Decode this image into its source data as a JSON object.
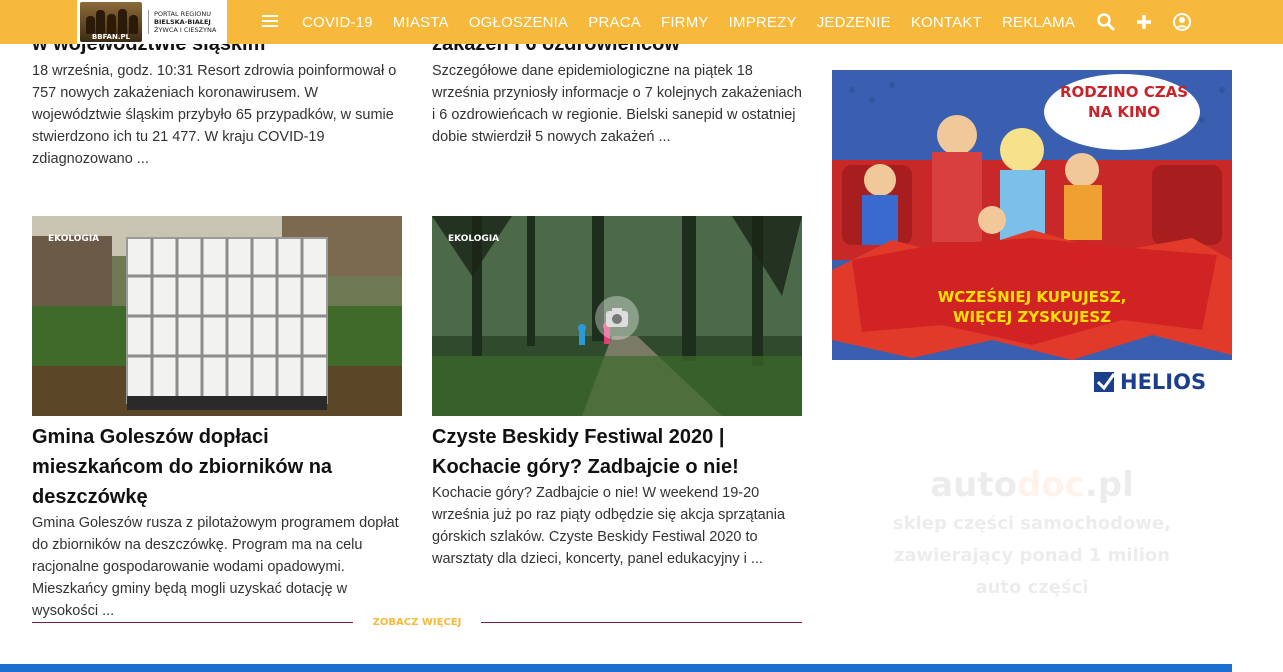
{
  "header": {
    "logo_word": "BBFAN.PL",
    "logo_line1": "PORTAL REGIONU",
    "logo_line2": "BIELSKA-BIAŁEJ",
    "logo_line3": "ŻYWCA I CIESZYNA",
    "nav": [
      "COVID-19",
      "MIASTA",
      "OGŁOSZENIA",
      "PRACA",
      "FIRMY",
      "IMPREZY",
      "JEDZENIE",
      "KONTAKT",
      "REKLAMA"
    ],
    "icons": [
      "search-icon",
      "plus-icon",
      "user-icon"
    ],
    "color": "#f6b93b"
  },
  "articles_top": [
    {
      "title_partial": "w województwie śląskim",
      "excerpt": "18 września, godz. 10:31 Resort zdrowia poinformował o 757 nowych zakażeniach koronawirusem. W województwie śląskim przybyło 65 przypadków, w sumie stwierdzono ich tu 21 477. W kraju COVID-19 zdiagnozowano ..."
    },
    {
      "title_partial": "zakażeń i 6 ozdrowieńców",
      "excerpt": "Szczegółowe dane epidemiologiczne na piątek 18 września przyniosły informacje o 7 kolejnych zakażeniach i 6 ozdrowieńcach w regionie. Bielski sanepid w ostatniej dobie stwierdził 5 nowych zakażeń ..."
    }
  ],
  "articles_bottom": [
    {
      "tag": "EKOLOGIA",
      "title": "Gmina Goleszów dopłaci mieszkańcom do zbiorników na deszczówkę",
      "excerpt": "Gmina Goleszów rusza z pilotażowym programem dopłat do zbiorników na deszczówkę. Program ma na celu racjonalne gospodarowanie wodami opadowymi. Mieszkańcy gminy będą mogli uzyskać dotację  w wysokości ..."
    },
    {
      "tag": "EKOLOGIA",
      "title": "Czyste Beskidy Festiwal 2020 | Kochacie góry? Zadbajcie o nie!",
      "excerpt": "Kochacie góry? Zadbajcie o nie! W weekend 19-20 września już po raz piąty odbędzie się akcja sprzątania górskich szlaków. Czyste Beskidy Festiwal 2020 to warsztaty dla dzieci, koncerty, panel edukacyjny i ..."
    }
  ],
  "see_more": "ZOBACZ WIĘCEJ",
  "ad_helios": {
    "bubble": "RODZINO CZAS NA KINO",
    "slogan_line1": "WCZEŚNIEJ KUPUJESZ,",
    "slogan_line2": "WIĘCEJ ZYSKUJESZ",
    "brand": "HELIOS"
  },
  "ad_autodoc": {
    "brand_a": "auto",
    "brand_b": "doc",
    "brand_c": ".pl",
    "line1": "sklep części samochodowe,",
    "line2": "zawierający ponad 1 milion",
    "line3": "auto części"
  }
}
